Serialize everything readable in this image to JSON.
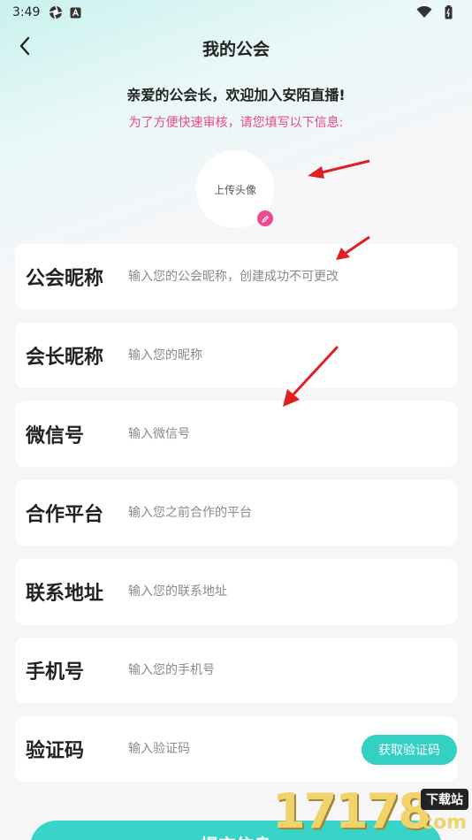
{
  "status_bar": {
    "time": "3:49",
    "icons": [
      "aperture-icon",
      "a-badge-icon",
      "wifi-icon",
      "battery-icon"
    ]
  },
  "header": {
    "title": "我的公会",
    "back_icon": "chevron-left-icon"
  },
  "welcome": {
    "text": "亲爱的公会长，欢迎加入安陌直播!",
    "subtitle": "为了方便快速审核，请您填写以下信息:"
  },
  "avatar": {
    "label": "上传头像",
    "edit_icon": "pencil-icon"
  },
  "form": {
    "fields": [
      {
        "label": "公会昵称",
        "placeholder": "输入您的公会昵称，创建成功不可更改",
        "value": ""
      },
      {
        "label": "会长昵称",
        "placeholder": "输入您的昵称",
        "value": ""
      },
      {
        "label": "微信号",
        "placeholder": "输入微信号",
        "value": ""
      },
      {
        "label": "合作平台",
        "placeholder": "输入您之前合作的平台",
        "value": ""
      },
      {
        "label": "联系地址",
        "placeholder": "输入您的联系地址",
        "value": ""
      },
      {
        "label": "手机号",
        "placeholder": "输入您的手机号",
        "value": ""
      },
      {
        "label": "验证码",
        "placeholder": "输入验证码",
        "value": ""
      }
    ],
    "get_code_label": "获取验证码",
    "submit_label": "提交信息"
  },
  "watermark": {
    "digits": "17178",
    "tag": "下载站",
    "suffix": ".com"
  },
  "colors": {
    "accent_teal": "#35d0c4",
    "accent_pink": "#e8488c",
    "annotation_red": "#e02020"
  }
}
